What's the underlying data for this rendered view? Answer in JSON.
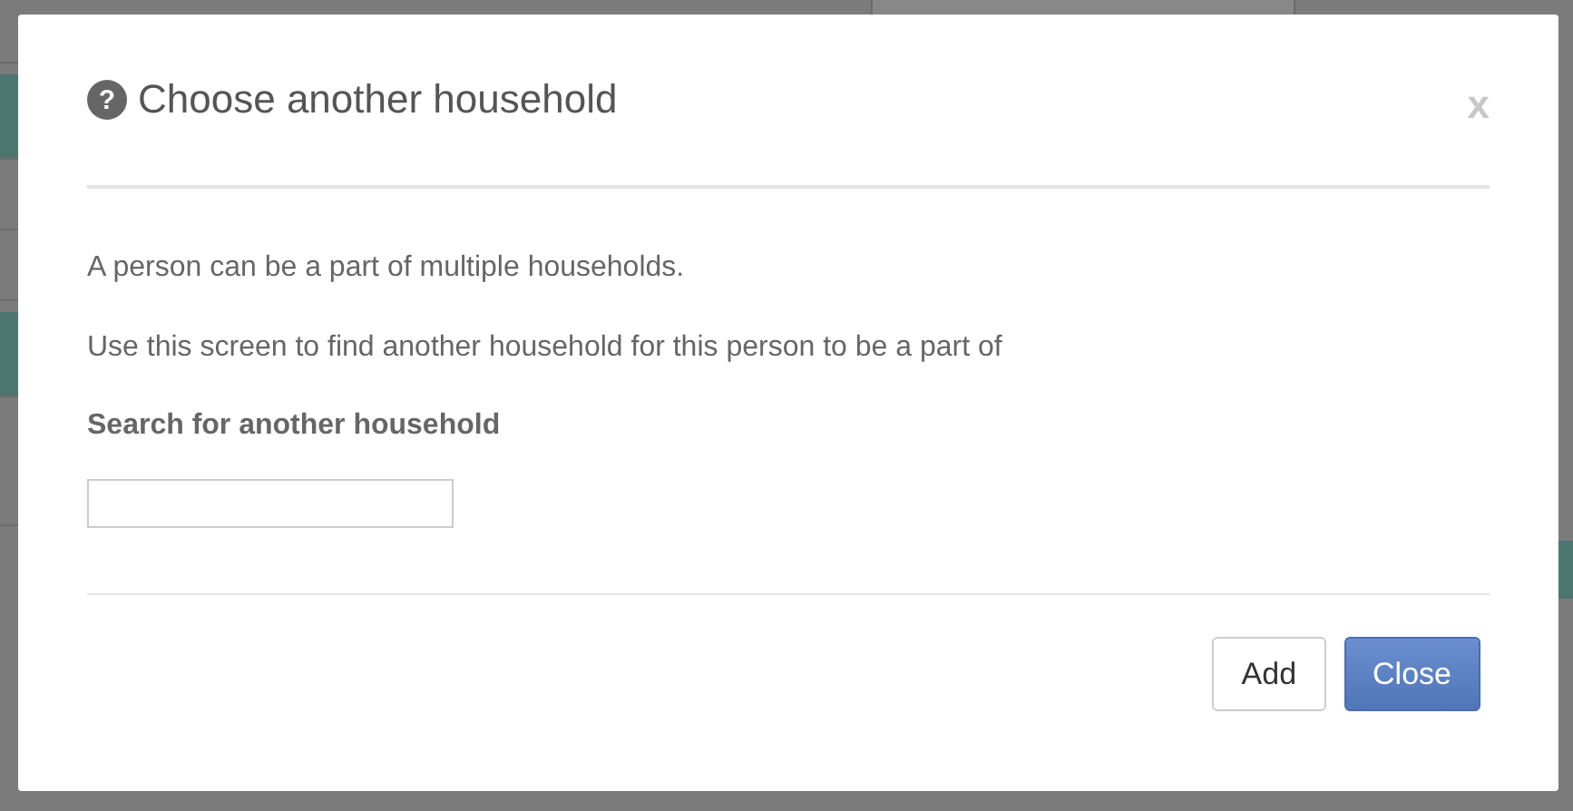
{
  "dialog": {
    "help_glyph": "?",
    "title": "Choose another household",
    "close": "x",
    "paragraphs": [
      "A person can be a part of multiple households.",
      "Use this screen to find another household for this person to be a part of"
    ],
    "search_label": "Search for another household",
    "buttons": [
      {
        "label": "Add",
        "kind": "default"
      },
      {
        "label": "Close",
        "kind": "primary"
      }
    ]
  }
}
